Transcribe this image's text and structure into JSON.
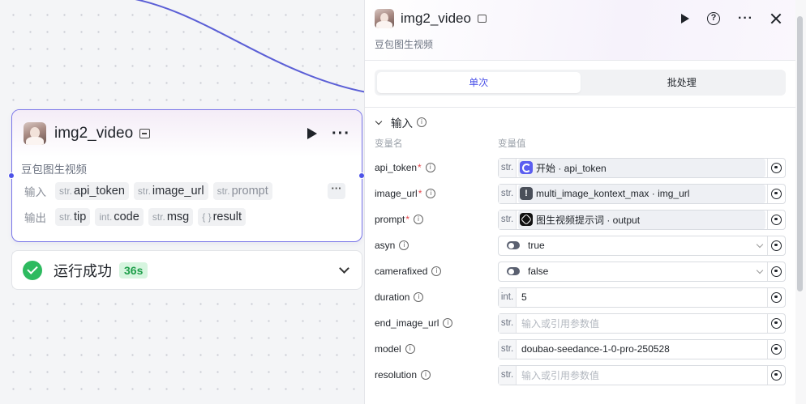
{
  "canvas": {
    "node": {
      "title": "img2_video",
      "description": "豆包图生视频",
      "input_label": "输入",
      "output_label": "输出",
      "inputs": [
        {
          "type": "str.",
          "name": "api_token"
        },
        {
          "type": "str.",
          "name": "image_url"
        },
        {
          "type": "str.",
          "name": "prompt"
        }
      ],
      "outputs": [
        {
          "type": "str.",
          "name": "tip"
        },
        {
          "type": "int.",
          "name": "code"
        },
        {
          "type": "str.",
          "name": "msg"
        },
        {
          "type": "{ }",
          "name": "result"
        }
      ],
      "more_label": "···"
    },
    "run": {
      "status": "运行成功",
      "duration": "36s"
    },
    "edge_color": "#5b5fd6"
  },
  "panel": {
    "title": "img2_video",
    "description": "豆包图生视频",
    "tabs": [
      {
        "label": "单次",
        "active": true
      },
      {
        "label": "批处理",
        "active": false
      }
    ],
    "section_title": "输入",
    "columns": {
      "name": "变量名",
      "value": "变量值"
    },
    "params": [
      {
        "name": "api_token",
        "required": true,
        "type": "str.",
        "kind": "ref",
        "icon": "start-icon",
        "value": "开始 · api_token"
      },
      {
        "name": "image_url",
        "required": true,
        "type": "str.",
        "kind": "ref",
        "icon": "warning-icon",
        "value": "multi_image_kontext_max · img_url"
      },
      {
        "name": "prompt",
        "required": true,
        "type": "str.",
        "kind": "ref",
        "icon": "gpt-icon",
        "value": "图生视频提示词 · output"
      },
      {
        "name": "asyn",
        "required": false,
        "type": "",
        "kind": "bool",
        "value": "true"
      },
      {
        "name": "camerafixed",
        "required": false,
        "type": "",
        "kind": "bool",
        "value": "false"
      },
      {
        "name": "duration",
        "required": false,
        "type": "int.",
        "kind": "literal",
        "value": "5"
      },
      {
        "name": "end_image_url",
        "required": false,
        "type": "str.",
        "kind": "placeholder",
        "value": "输入或引用参数值"
      },
      {
        "name": "model",
        "required": false,
        "type": "str.",
        "kind": "literal",
        "value": "doubao-seedance-1-0-pro-250528"
      },
      {
        "name": "resolution",
        "required": false,
        "type": "str.",
        "kind": "placeholder",
        "value": "输入或引用参数值"
      }
    ]
  },
  "colors": {
    "accent": "#4d53e8",
    "node_border": "#7a76e8",
    "success": "#2dba5f",
    "required": "#e5484d"
  }
}
